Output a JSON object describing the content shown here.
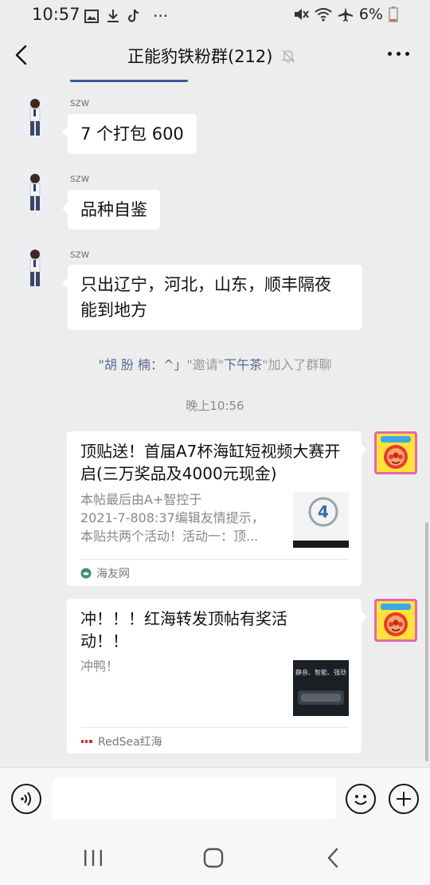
{
  "status_bar": {
    "time": "10:57",
    "dots": "···",
    "battery": "6%"
  },
  "header": {
    "title": "正能豹铁粉群(212)"
  },
  "messages": [
    {
      "sender": "szw",
      "text": "7 个打包 600"
    },
    {
      "sender": "szw",
      "text": "品种自鉴"
    },
    {
      "sender": "szw",
      "text_line1": "只出辽宁，河北，山东，顺丰隔夜",
      "text_line2": "能到地方"
    }
  ],
  "system_notice": {
    "q1": "\"",
    "inviter": "胡 朌 楠：^」",
    "mid": "\"邀请\"",
    "invitee": "下午茶",
    "tail": "\"加入了群聊"
  },
  "timestamp": "晚上10:56",
  "cards": [
    {
      "title": "顶贴送！首届A7杯海缸短视频大赛开启(三万奖品及4000元现金)",
      "desc_line1": "本帖最后由A+智控于",
      "desc_line2": "2021-7-808:37编辑友情提示，",
      "desc_line3": "本贴共两个活动！活动一：顶...",
      "source": "海友网"
    },
    {
      "title": "冲！！！红海转发顶帖有奖活动！！",
      "desc_line1": "冲鸭！",
      "source": "RedSea红海",
      "thumb_text": "静音、智能、强劲"
    }
  ],
  "colors": {
    "background": "#ededed",
    "link": "#576b95",
    "bubble": "#ffffff"
  }
}
